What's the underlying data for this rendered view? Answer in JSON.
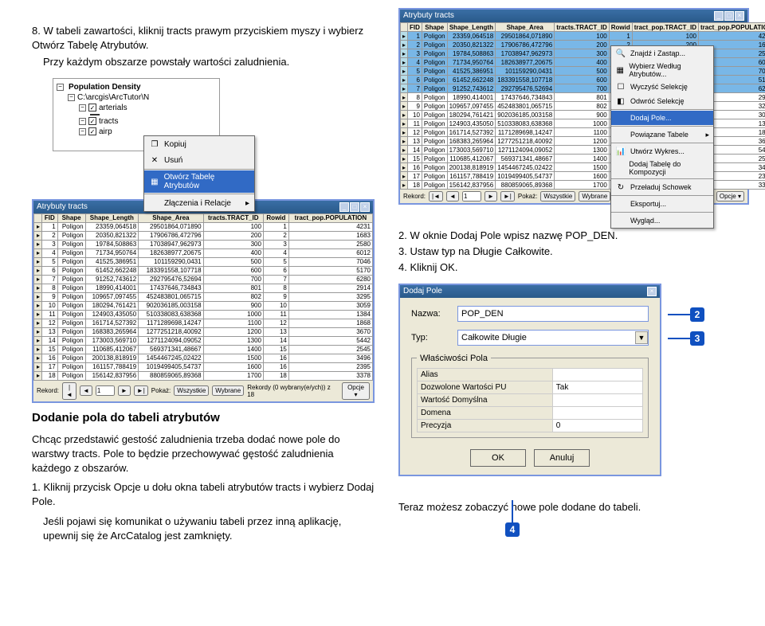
{
  "step8": {
    "num": "8.",
    "text1": "W tabeli zawartości, kliknij tracts prawym przyciskiem myszy i wybierz Otwórz Tabelę Atrybutów.",
    "text2": "Przy każdym obszarze powstały wartości zaludnienia."
  },
  "toc": {
    "root": "Population Density",
    "path": "C:\\arcgis\\ArcTutor\\N",
    "arterials": "arterials",
    "tracts": "tracts",
    "airp": "airp",
    "trac": "trac"
  },
  "ctx": {
    "copy": "Kopiuj",
    "remove": "Usuń",
    "open_table": "Otwórz Tabelę Atrybutów",
    "joins": "Złączenia i Relacje"
  },
  "right_ctx": {
    "find": "Znajdź i Zastąp...",
    "select_by": "Wybierz Według Atrybutów...",
    "clear_sel": "Wyczyść Selekcję",
    "switch_sel": "Odwróć Selekcję",
    "add_field": "Dodaj Pole...",
    "related": "Powiązane Tabele",
    "create_chart": "Utwórz Wykres...",
    "add_to_layout": "Dodaj Tabelę do Kompozycji",
    "reload": "Przeładuj Schowek",
    "export": "Eksportuj...",
    "appearance": "Wygląd..."
  },
  "table_win": {
    "title": "Atrybuty tracts",
    "cols": [
      "FID",
      "Shape",
      "Shape_Length",
      "Shape_Area",
      "tracts.TRACT_ID",
      "Rowid",
      "tract_pop.TRACT_ID",
      "tract_pop.POPULATION"
    ],
    "cols2": [
      "FID",
      "Shape",
      "Shape_Length",
      "Shape_Area",
      "tracts.TRACT_ID",
      "Rowid",
      "tract_pop.POPULATION"
    ],
    "rows": [
      [
        "1",
        "Poligon",
        "23359,064518",
        "29501864,071890",
        "100",
        "1",
        "100",
        "4231"
      ],
      [
        "2",
        "Poligon",
        "20350,821322",
        "17906786,472796",
        "200",
        "2",
        "200",
        "1683"
      ],
      [
        "3",
        "Poligon",
        "19784,508863",
        "17038947,962973",
        "300",
        "3",
        "300",
        "2580"
      ],
      [
        "4",
        "Poligon",
        "71734,950764",
        "182638977,20675",
        "400",
        "4",
        "400",
        "6012"
      ],
      [
        "5",
        "Poligon",
        "41525,386951",
        "101159290,0431",
        "500",
        "5",
        "500",
        "7046"
      ],
      [
        "6",
        "Poligon",
        "61452,662248",
        "183391558,107718",
        "600",
        "6",
        "600",
        "5170"
      ],
      [
        "7",
        "Poligon",
        "91252,743612",
        "292795476,52694",
        "700",
        "7",
        "700",
        "6280"
      ],
      [
        "8",
        "Poligon",
        "18990,414001",
        "17437646,734843",
        "801",
        "8",
        "801",
        "2914"
      ],
      [
        "9",
        "Poligon",
        "109657,097455",
        "452483801,065715",
        "802",
        "9",
        "802",
        "3295"
      ],
      [
        "10",
        "Poligon",
        "180294,761421",
        "902036185,003158",
        "900",
        "10",
        "900",
        "3059"
      ],
      [
        "11",
        "Poligon",
        "124903,435050",
        "510338083,638368",
        "1000",
        "11",
        "1000",
        "1384"
      ],
      [
        "12",
        "Poligon",
        "161714,527392",
        "1171289698,14247",
        "1100",
        "12",
        "1100",
        "1868"
      ],
      [
        "13",
        "Poligon",
        "168383,265964",
        "1277251218,40092",
        "1200",
        "13",
        "1200",
        "3670"
      ],
      [
        "14",
        "Poligon",
        "173003,569710",
        "1271124094,09052",
        "1300",
        "14",
        "1300",
        "5442"
      ],
      [
        "15",
        "Poligon",
        "110685,412067",
        "569371341,48667",
        "1400",
        "15",
        "1400",
        "2545"
      ],
      [
        "16",
        "Poligon",
        "200138,818919",
        "1454467245,02422",
        "1500",
        "16",
        "1500",
        "3496"
      ],
      [
        "17",
        "Poligon",
        "161157,788419",
        "1019499405,54737",
        "1600",
        "16",
        "1600",
        "2395"
      ],
      [
        "18",
        "Poligon",
        "156142,837956",
        "880859065,89368",
        "1700",
        "18",
        "1700",
        "3378"
      ]
    ],
    "status_record": "Rekord:",
    "show": "Pokaż:",
    "show_all": "Wszystkie",
    "show_sel": "Wybrane",
    "records_txt": "Rekordy (0 wybrany(e/ych)) z 18",
    "opts": "Opcje"
  },
  "steps_right": {
    "s2": "W oknie  Dodaj Pole wpisz nazwę POP_DEN.",
    "s3": "Ustaw typ na Długie Całkowite.",
    "s4": "Kliknij OK.",
    "n2": "2.",
    "n3": "3.",
    "n4": "4."
  },
  "dlg": {
    "title": "Dodaj Pole",
    "name_lbl": "Nazwa:",
    "name_val": "POP_DEN",
    "type_lbl": "Typ:",
    "type_val": "Całkowite Długie",
    "props_lbl": "Właściwości Pola",
    "alias": "Alias",
    "allow_null": "Dozwolone Wartości PU",
    "allow_null_val": "Tak",
    "default_val": "Wartość Domyślna",
    "domain": "Domena",
    "precision": "Precyzja",
    "precision_val": "0",
    "ok": "OK",
    "cancel": "Anuluj"
  },
  "section": {
    "heading": "Dodanie pola do tabeli atrybutów",
    "body1": "Chcąc przedstawić gestość zaludnienia trzeba dodać nowe pole do warstwy tracts. Pole to będzie przechowywać gęstość zaludnienia każdego z obszarów.",
    "step1_num": "1.",
    "step1": "Kliknij przycisk Opcje u dołu okna tabeli atrybutów tracts i wybierz Dodaj Pole.",
    "step1_note": "Jeśli pojawi się komunikat o używaniu tabeli przez inną aplikację, upewnij się że ArcCatalog jest zamknięty.",
    "final_note": "Teraz możesz zobaczyć nowe pole dodane do tabeli."
  },
  "badges": {
    "b2": "2",
    "b3": "3",
    "b4": "4"
  },
  "nav": {
    "first": "|◄",
    "prev": "◄",
    "rec": "1",
    "next": "►",
    "last": "►|"
  }
}
